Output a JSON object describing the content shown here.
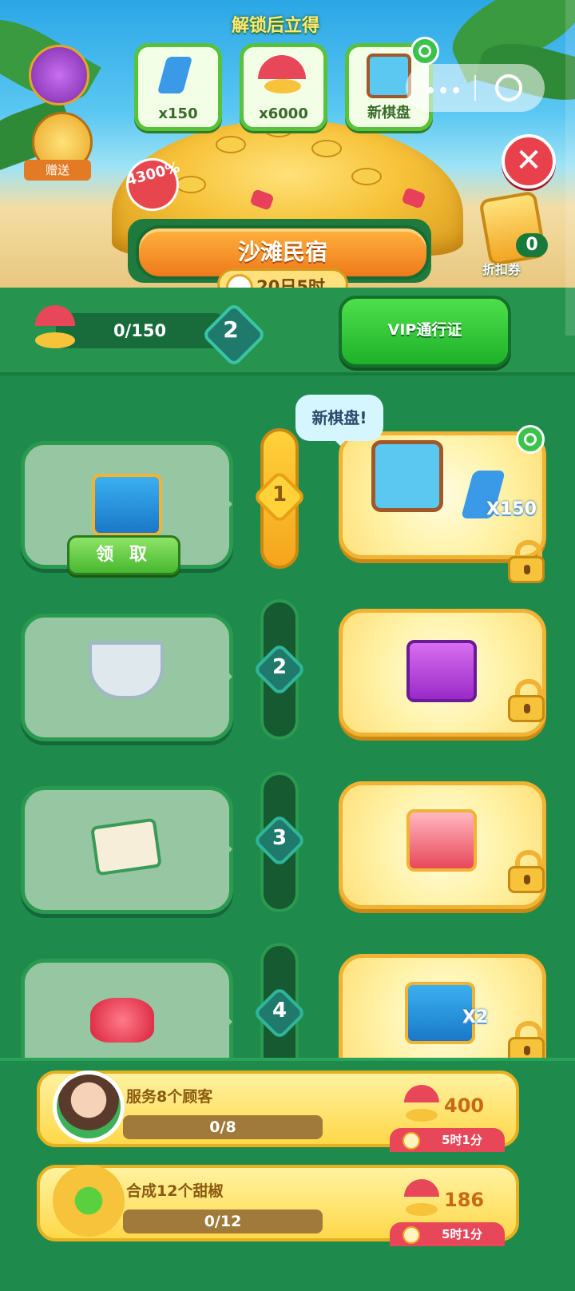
{
  "header": {
    "unlock_hint": "解锁后立得",
    "unlock_rewards": [
      {
        "label": "x150",
        "icon": "lightning-icon"
      },
      {
        "label": "x6000",
        "icon": "umbrella-coin-icon"
      },
      {
        "label": "新棋盘",
        "icon": "board-icon"
      }
    ],
    "gift_label": "赠送",
    "bonus_percent": "4300%",
    "coupon_count": "0",
    "coupon_label": "折扣券"
  },
  "event": {
    "title": "沙滩民宿",
    "timer": "20日5时"
  },
  "progress": {
    "value": "0/150",
    "level": "2",
    "vip_button": "VIP通行证"
  },
  "track": {
    "bubble": "新棋盘!",
    "claim_button": "领 取",
    "levels": [
      {
        "num": "1",
        "free_item": "blue-chest-icon",
        "vip_item": "board-icon",
        "vip_extra": "X150",
        "active": true
      },
      {
        "num": "2",
        "free_item": "corn-soup-icon",
        "vip_item": "purple-chest-icon",
        "vip_extra": ""
      },
      {
        "num": "3",
        "free_item": "fried-rice-icon",
        "vip_item": "mystery-chest-icon",
        "vip_extra": ""
      },
      {
        "num": "4",
        "free_item": "ruby-gems-icon",
        "vip_item": "blue-chest-icon",
        "vip_extra": "X2"
      }
    ]
  },
  "tasks": [
    {
      "title": "服务8个顾客",
      "progress": "0/8",
      "reward": "400",
      "time": "5时1分"
    },
    {
      "title": "合成12个甜椒",
      "progress": "0/12",
      "reward": "186",
      "time": "5时1分"
    }
  ],
  "colors": {
    "bg_green": "#1e8a4c",
    "banner_orange": "#ee7a1a",
    "vip_gold": "#ffe07a",
    "accent_red": "#e8414c"
  }
}
